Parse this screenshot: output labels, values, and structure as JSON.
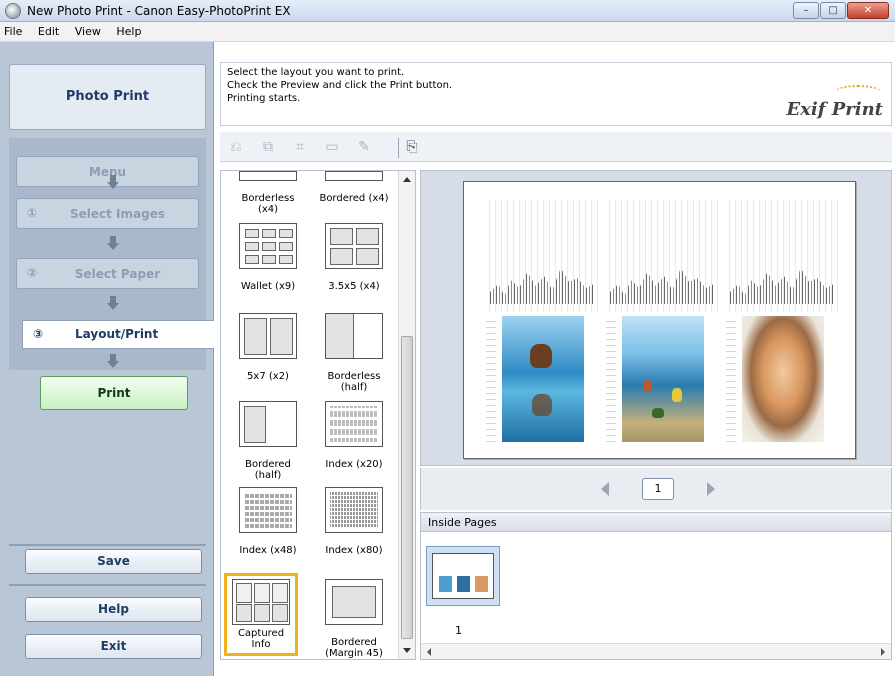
{
  "window": {
    "title": "New Photo Print - Canon Easy-PhotoPrint EX"
  },
  "menu": [
    "File",
    "Edit",
    "View",
    "Help"
  ],
  "sidebar": {
    "header": "Photo Print",
    "menu_label": "Menu",
    "steps": [
      {
        "num": "①",
        "label": "Select Images"
      },
      {
        "num": "②",
        "label": "Select Paper"
      },
      {
        "num": "③",
        "label": "Layout/Print"
      }
    ],
    "print_label": "Print",
    "save_label": "Save",
    "help_label": "Help",
    "exit_label": "Exit"
  },
  "instructions": {
    "line1": "Select the layout you want to print.",
    "line2": "Check the Preview and click the Print button.",
    "line3": "Printing starts.",
    "logo": "Exif Print"
  },
  "toolbar_icons": [
    "rotate-left-icon",
    "rotate-right-icon",
    "crop-icon",
    "frame-icon",
    "correct-icon",
    "layout-settings-icon"
  ],
  "layouts": [
    {
      "label": "Borderless\n(x4)"
    },
    {
      "label": "Bordered (x4)"
    },
    {
      "label": "Wallet (x9)"
    },
    {
      "label": "3.5x5 (x4)"
    },
    {
      "label": "5x7 (x2)"
    },
    {
      "label": "Borderless\n(half)"
    },
    {
      "label": "Bordered\n(half)"
    },
    {
      "label": "Index (x20)"
    },
    {
      "label": "Index (x48)"
    },
    {
      "label": "Index (x80)"
    },
    {
      "label": "Captured\nInfo"
    },
    {
      "label": "Bordered\n(Margin 45)"
    }
  ],
  "preview": {
    "page_number": "1"
  },
  "inside_pages": {
    "title": "Inside Pages",
    "thumb_number": "1"
  },
  "colors": {
    "sidebar_bg": "#b9c6d6",
    "print_button": "#c9efc3",
    "selected_layout": "#f2b21b"
  }
}
